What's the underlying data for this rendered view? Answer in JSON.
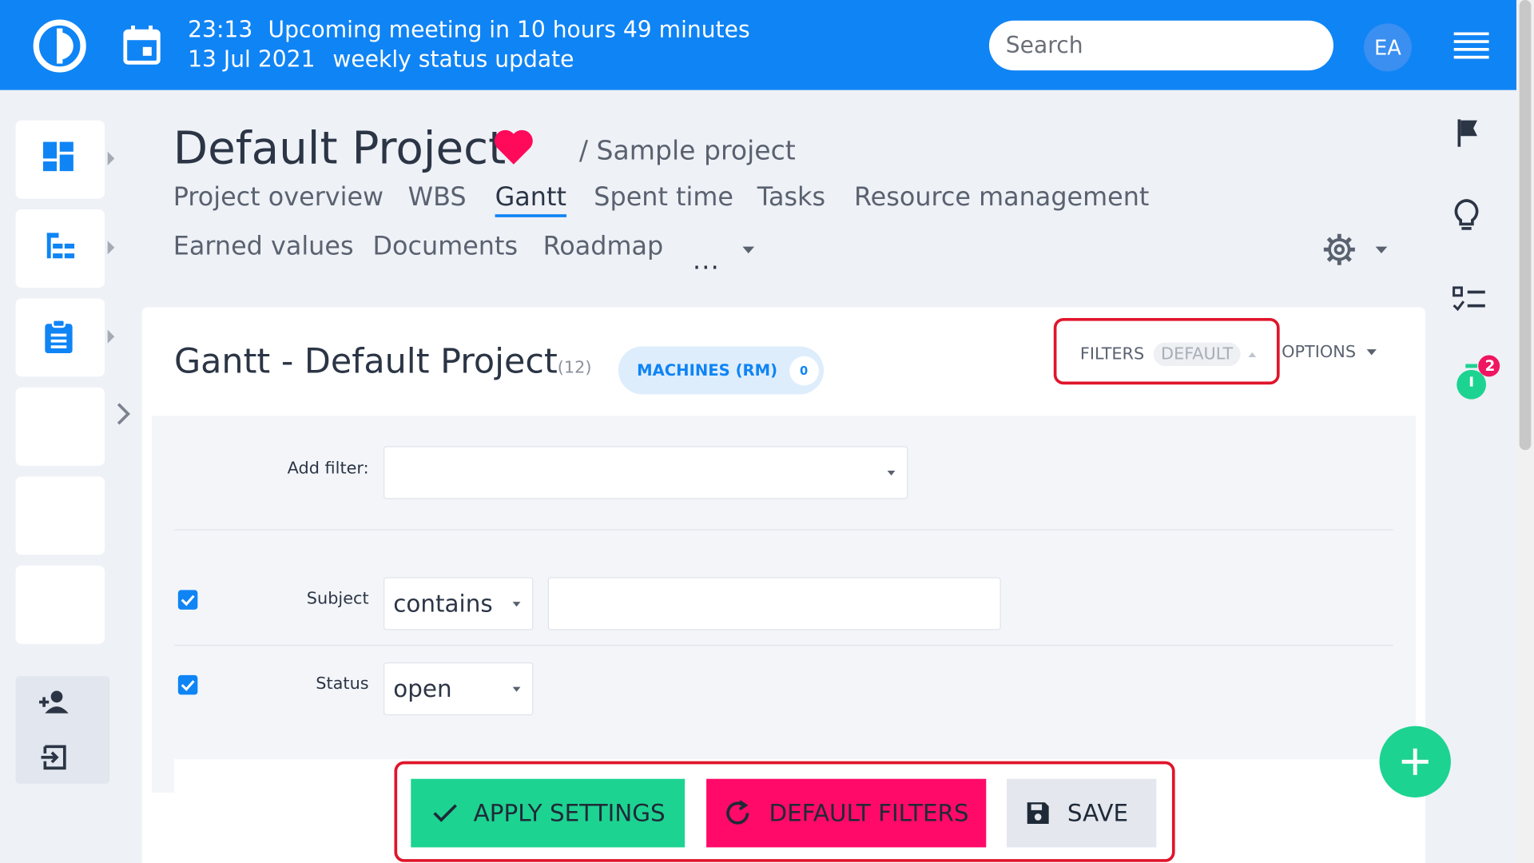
{
  "topbar": {
    "time": "23:13",
    "meeting": "Upcoming meeting in 10 hours 49 minutes",
    "date": "13 Jul 2021",
    "meeting_title": "weekly status update",
    "search_placeholder": "Search",
    "avatar_initials": "EA"
  },
  "project": {
    "name": "Default Project",
    "parent": "/ Sample project"
  },
  "nav": {
    "row1": [
      "Project overview",
      "WBS",
      "Gantt",
      "Spent time",
      "Tasks",
      "Resource management"
    ],
    "row2": [
      "Earned values",
      "Documents",
      "Roadmap"
    ],
    "more": "...",
    "active": "Gantt"
  },
  "gantt": {
    "title": "Gantt - Default Project",
    "count": "(12)",
    "machines_label": "MACHINES (RM)",
    "machines_count": "0",
    "filters_label": "FILTERS",
    "filters_badge": "DEFAULT",
    "options_label": "OPTIONS"
  },
  "filters": {
    "add_filter_label": "Add filter:",
    "add_filter_value": "",
    "subject_label": "Subject",
    "subject_operator": "contains",
    "subject_value": "",
    "status_label": "Status",
    "status_operator": "open"
  },
  "actions": {
    "apply": "APPLY SETTINGS",
    "default": "DEFAULT FILTERS",
    "save": "SAVE"
  },
  "rail": {
    "timer_badge": "2"
  },
  "colors": {
    "primary": "#0f84f5",
    "apply": "#1dd391",
    "default": "#ff0a68",
    "save_bg": "#e4e7ee",
    "highlight": "#e0152a"
  }
}
